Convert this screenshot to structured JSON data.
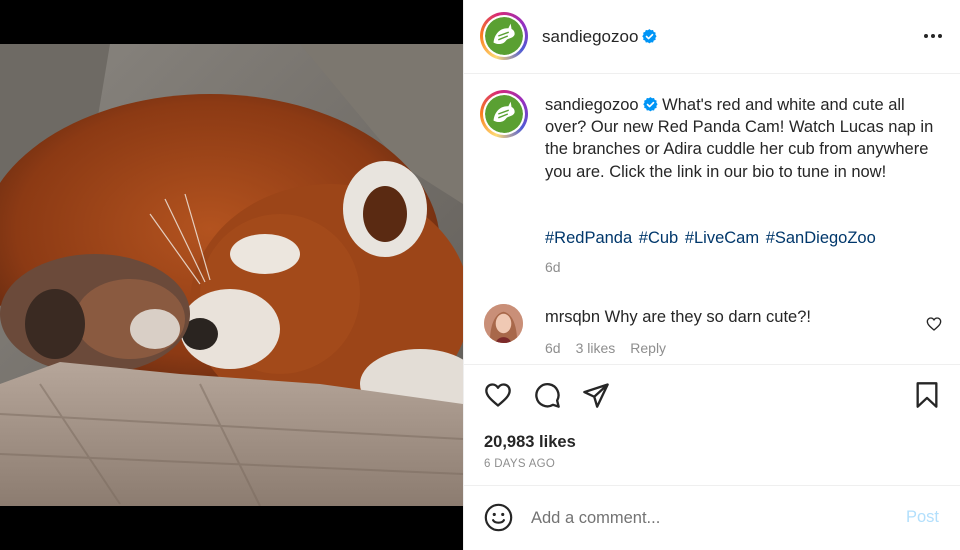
{
  "post": {
    "username": "sandiegozoo",
    "verified": true,
    "caption": "What's red and white and cute all over? Our new Red Panda Cam! Watch Lucas nap in the branches or Adira cuddle her cub from anywhere you are. Click the link in our bio to tune in now!",
    "hashtags": [
      "#RedPanda",
      "#Cub",
      "#LiveCam",
      "#SanDiegoZoo"
    ],
    "caption_time": "6d",
    "likes": "20,983 likes",
    "date": "6 DAYS AGO"
  },
  "comment": {
    "username": "mrsqbn",
    "text": "Why are they so darn cute?!",
    "time": "6d",
    "likes": "3 likes",
    "reply_label": "Reply"
  },
  "add_comment": {
    "placeholder": "Add a comment...",
    "post_label": "Post"
  },
  "icons": {
    "more": "more-options-icon",
    "verified": "verified-badge-icon",
    "like": "heart-icon",
    "comment": "speech-bubble-icon",
    "share": "paper-plane-icon",
    "save": "bookmark-icon",
    "emoji": "emoji-icon"
  },
  "colors": {
    "link": "#00376b",
    "verified": "#0095f6",
    "post_button_disabled": "#b2dffc",
    "muted_text": "#8e8e8e"
  }
}
